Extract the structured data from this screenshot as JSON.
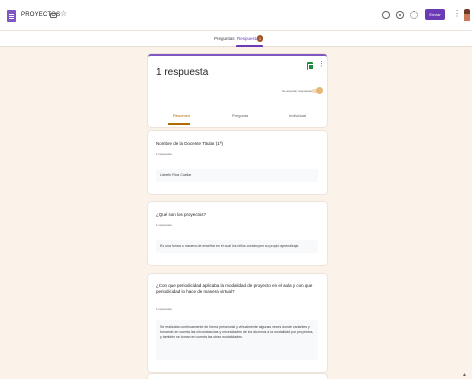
{
  "header": {
    "title": "PROYECTOS",
    "send_label": "Enviar",
    "icons": [
      "forms-logo-icon",
      "folder-icon",
      "star-icon",
      "palette-icon",
      "preview-icon",
      "settings-icon",
      "more-vert-icon",
      "avatar"
    ]
  },
  "tabs": {
    "questions_label": "Preguntas",
    "responses_label": "Respuestas",
    "responses_count": "1"
  },
  "summary": {
    "title": "1 respuesta",
    "accepting_label": "Se aceptan respuestas",
    "subtabs": {
      "summary": "Resumen",
      "question": "Pregunta",
      "individual": "Individual"
    }
  },
  "questions": [
    {
      "title": "Nombre de la Docente Titular (1ª)",
      "count": "1 respuesta",
      "answer": "Lizbeth Rios Cuellar"
    },
    {
      "title": "¿Qué son los proyectos?",
      "count": "1 respuesta",
      "answer": "Es una forma o manera de enseñar en el cual los niños construyen su propio aprendizaje."
    },
    {
      "title": "¿Con que periodicidad aplicaba la modalidad de proyecto en el aula y con que periodicidad lo hace de manera virtual?",
      "count": "1 respuesta",
      "answer": "Se realizaba continuamente de forma presencial y virtualmente algunas veces donde variantes y tomando en cuenta las circunstancias y necesidades de los alumnos a la modalidad por proyectos, y también se toman en cuenta las otras modalidades."
    }
  ],
  "colors": {
    "background": "#fbf2ea",
    "accent": "#6a3bb5",
    "summary_tab": "#b06a00",
    "sheets_green": "#1e8e3e"
  }
}
